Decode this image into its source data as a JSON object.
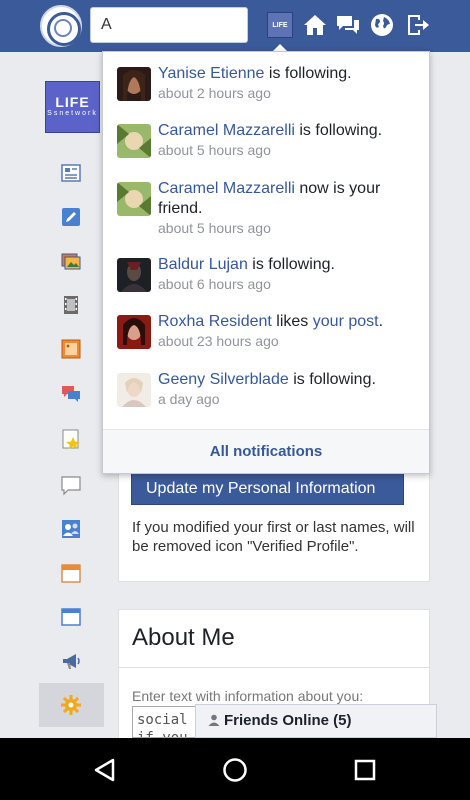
{
  "topbar": {
    "search_value": "A",
    "avatar_label": "LIFE"
  },
  "sidebar": {
    "logo_line1": "LIFE",
    "logo_line2": "Ssnetwork"
  },
  "notifications": {
    "items": [
      {
        "name": "Yanise Etienne",
        "action": "is following.",
        "time": "about 2 hours ago",
        "avatar_color": "#2a1a18"
      },
      {
        "name": "Caramel Mazzarelli",
        "action": "is following.",
        "time": "about 5 hours ago",
        "avatar_color": "#7a9a4c"
      },
      {
        "name": "Caramel Mazzarelli",
        "action": "now is your friend.",
        "time": "about 5 hours ago",
        "avatar_color": "#7a9a4c"
      },
      {
        "name": "Baldur Lujan",
        "action": "is following.",
        "time": "about 6 hours ago",
        "avatar_color": "#1d2025"
      },
      {
        "name": "Roxha Resident",
        "action": "likes",
        "object": "your post",
        "suffix": ".",
        "time": "about 23 hours ago",
        "avatar_color": "#8a1a12"
      },
      {
        "name": "Geeny Silverblade",
        "action": "is following.",
        "time": "a day ago",
        "avatar_color": "#e8dcd2"
      }
    ],
    "footer_label": "All notifications"
  },
  "main": {
    "update_button": "Update my Personal Information",
    "note": "If you modified your first or last names, will be removed icon \"Verified Profile\".",
    "about_title": "About Me",
    "about_hint": "Enter text with information about you:",
    "textarea_value": "social if you"
  },
  "friends_online": {
    "label": "Friends Online (5)"
  }
}
